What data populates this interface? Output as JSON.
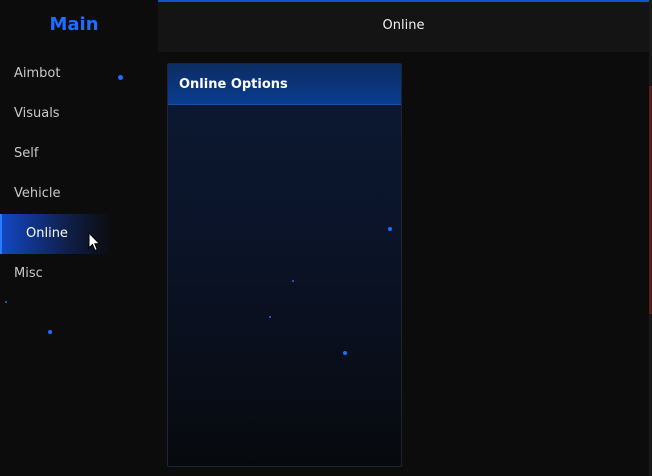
{
  "sidebar": {
    "title": "Main",
    "items": [
      {
        "label": "Aimbot"
      },
      {
        "label": "Visuals"
      },
      {
        "label": "Self"
      },
      {
        "label": "Vehicle"
      },
      {
        "label": "Online",
        "active": true
      },
      {
        "label": "Misc"
      }
    ]
  },
  "header": {
    "title": "Online"
  },
  "panel": {
    "title": "Online Options"
  },
  "colors": {
    "accent": "#1f6dff",
    "background": "#0b0b0c",
    "panel_header": "#0a3d8f"
  }
}
